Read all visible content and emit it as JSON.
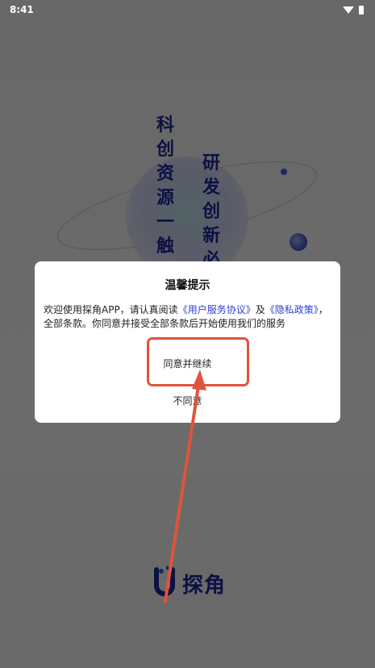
{
  "status_bar": {
    "time": "8:41"
  },
  "splash": {
    "slogan_left": [
      "科",
      "创",
      "资",
      "源",
      "一",
      "触"
    ],
    "slogan_right": [
      "研",
      "发",
      "创",
      "新",
      "必"
    ],
    "logo_text": "探角"
  },
  "dialog": {
    "title": "温馨提示",
    "body_prefix": "欢迎使用探角APP，请认真阅读",
    "link_user_agreement": "《用户服务协议》",
    "body_and": "及",
    "link_privacy": "《隐私政策》",
    "body_suffix": "，全部条款。你同意并接受全部条款后开始使用我们的服务",
    "agree_label": "同意并继续",
    "disagree_label": "不同意"
  },
  "colors": {
    "annotation": "#e0533c",
    "brand": "#1b2a9e",
    "link": "#2b3fd6"
  }
}
